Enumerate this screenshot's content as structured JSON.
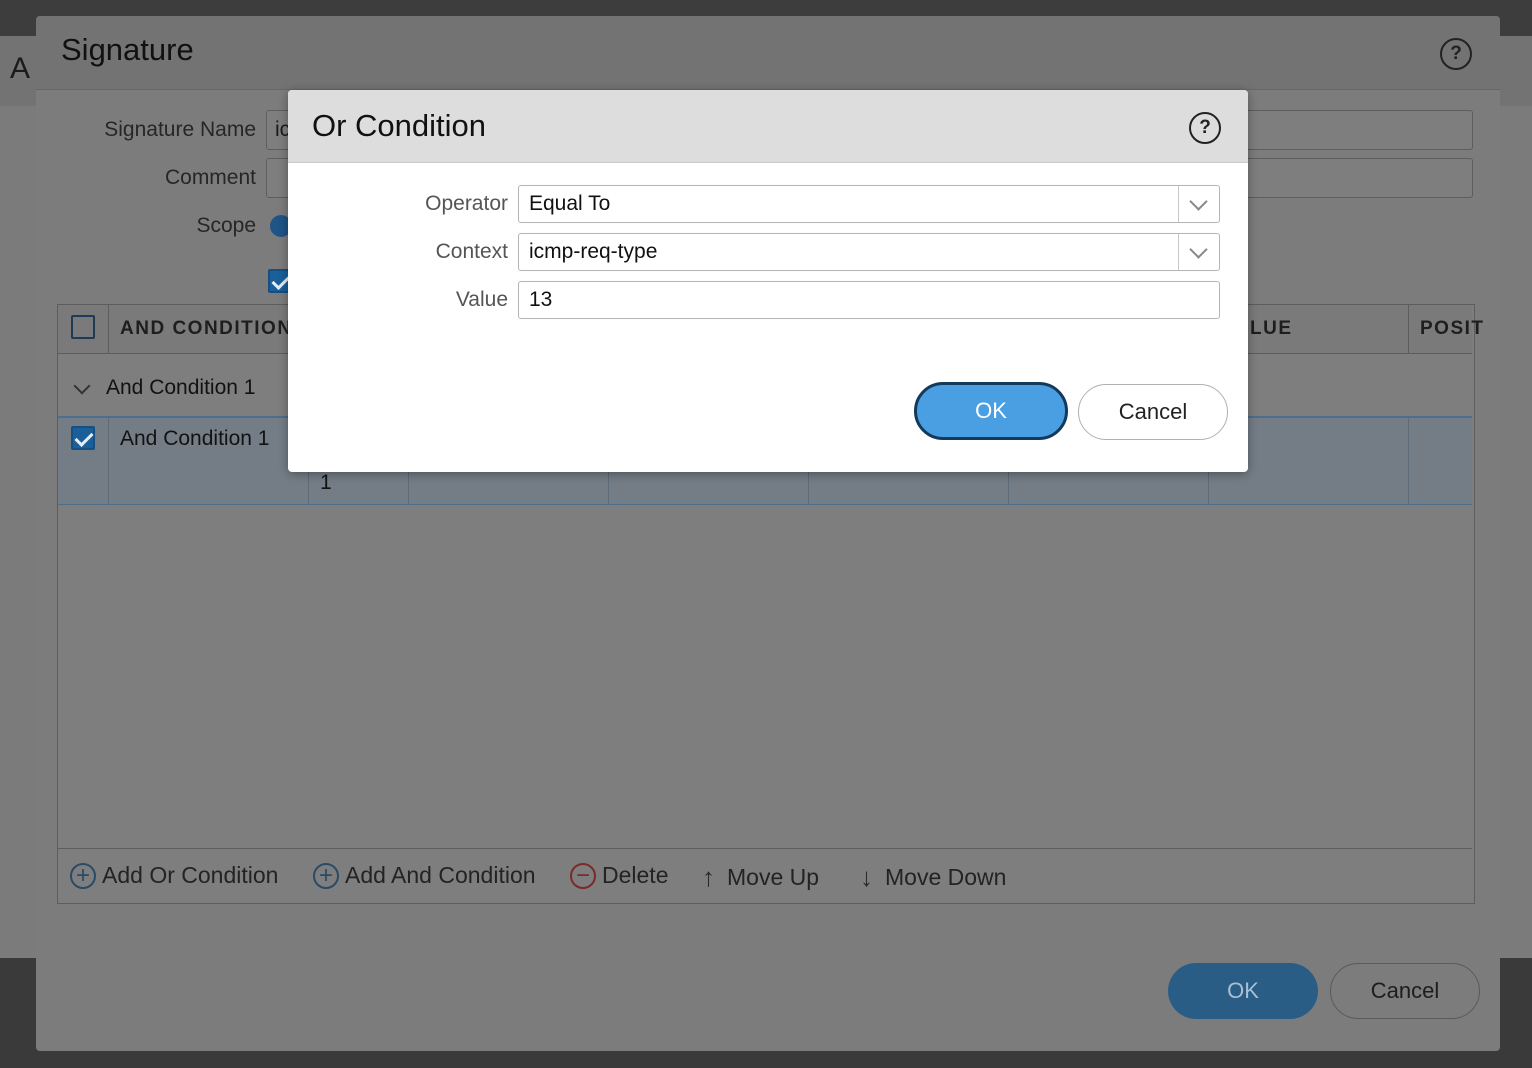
{
  "background_app": {
    "title_letter": "A"
  },
  "signature_dialog": {
    "title": "Signature",
    "fields": {
      "signature_name_label": "Signature Name",
      "signature_name_value": "ic",
      "comment_label": "Comment",
      "scope_label": "Scope"
    },
    "grid": {
      "columns": [
        "AND CONDITION",
        "LUE",
        "POSIT"
      ],
      "group_row": "And Condition 1",
      "selected_row": {
        "name": "And Condition 1",
        "number": "1"
      }
    },
    "toolbar": {
      "add_or": "Add Or Condition",
      "add_and": "Add And Condition",
      "delete": "Delete",
      "move_up": "Move Up",
      "move_down": "Move Down"
    },
    "ok_label": "OK",
    "cancel_label": "Cancel"
  },
  "or_condition_dialog": {
    "title": "Or Condition",
    "operator_label": "Operator",
    "operator_value": "Equal To",
    "context_label": "Context",
    "context_value": "icmp-req-type",
    "value_label": "Value",
    "value_value": "13",
    "ok_label": "OK",
    "cancel_label": "Cancel"
  },
  "colors": {
    "primary_button": "#4a9fe2",
    "overlay": "#7b7b7b",
    "modal_header": "#dddddd"
  },
  "icons": {
    "help": "help-icon",
    "add": "plus-circle-icon",
    "delete": "minus-circle-icon",
    "move_up": "arrow-up-icon",
    "move_down": "arrow-down-icon",
    "dropdown": "chevron-down-icon"
  }
}
